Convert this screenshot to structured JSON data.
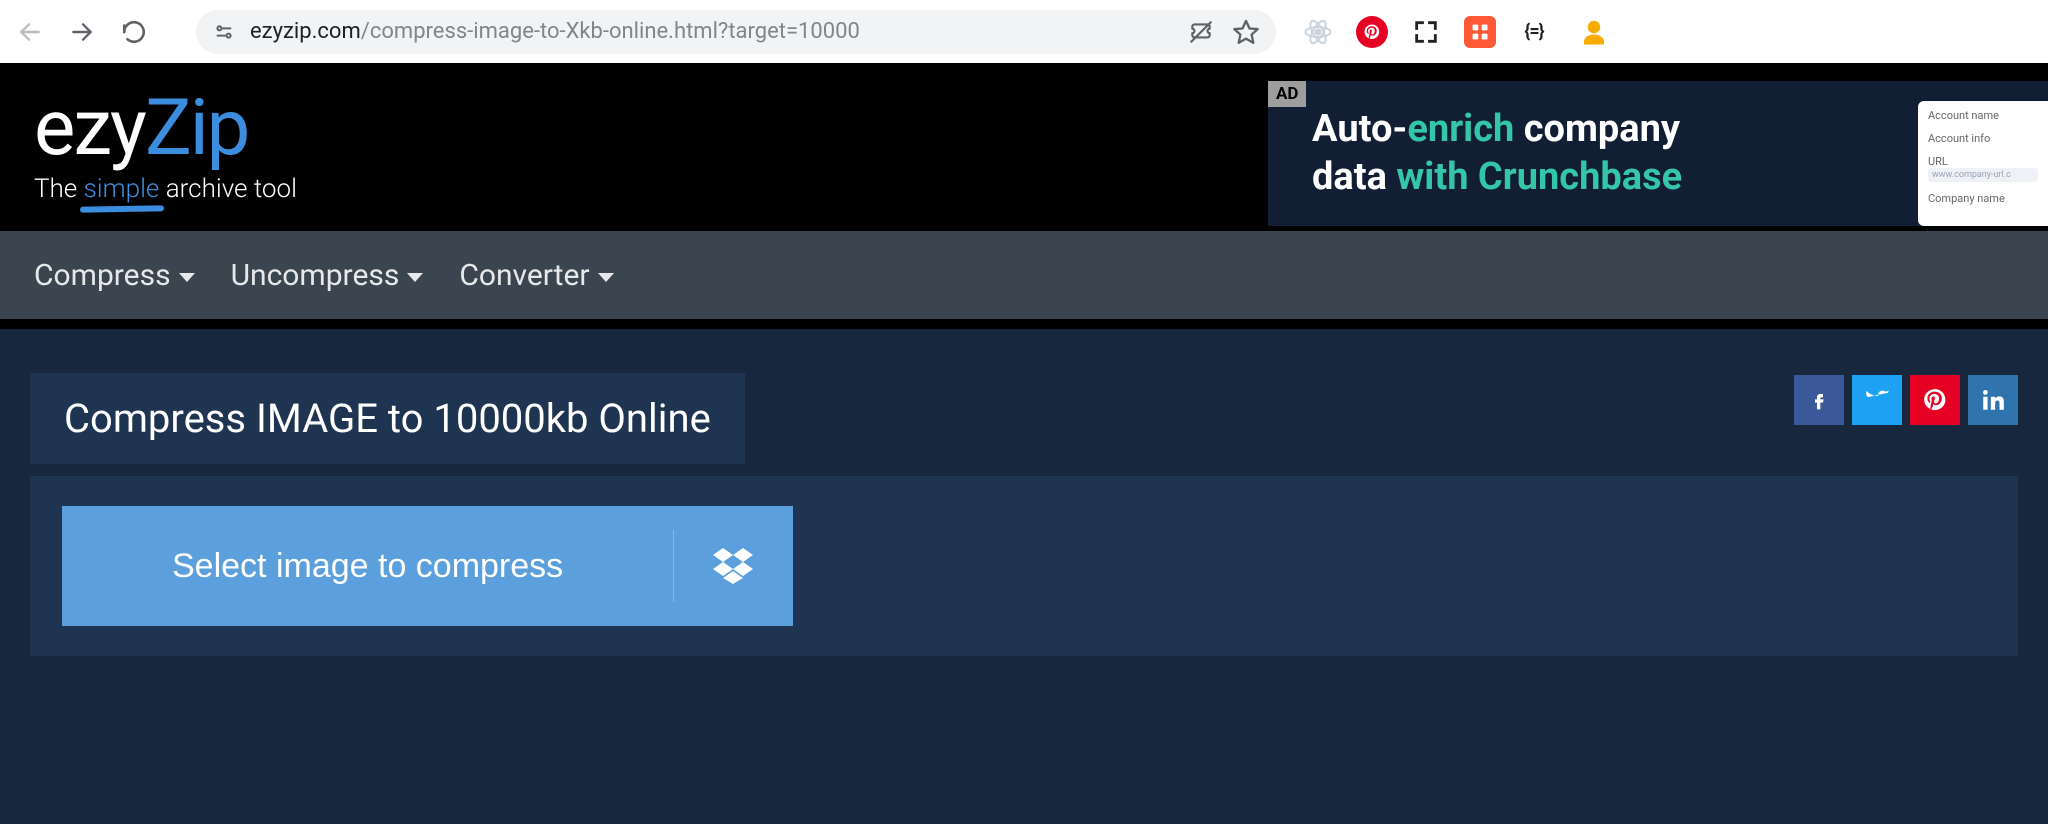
{
  "browser": {
    "url_host": "ezyzip.com",
    "url_path": "/compress-image-to-Xkb-online.html?target=10000"
  },
  "ext": {
    "braces": "{=}"
  },
  "logo": {
    "part1": "ezy",
    "part2": "Zip",
    "tag_pre": "The ",
    "tag_accent": "simple",
    "tag_post": " archive tool"
  },
  "ad": {
    "tag": "AD",
    "line1_a": "Auto-",
    "line1_b": "enrich",
    "line1_c": " company",
    "line2_a": "data ",
    "line2_b": "with Crunchbase",
    "form": {
      "f1": "Account name",
      "f2": "Account info",
      "f3": "URL",
      "f3v": "www.company-url.c",
      "f4": "Company name"
    }
  },
  "menu": {
    "compress": "Compress",
    "uncompress": "Uncompress",
    "converter": "Converter"
  },
  "page": {
    "title": "Compress IMAGE to 10000kb Online",
    "select_label": "Select image to compress"
  }
}
